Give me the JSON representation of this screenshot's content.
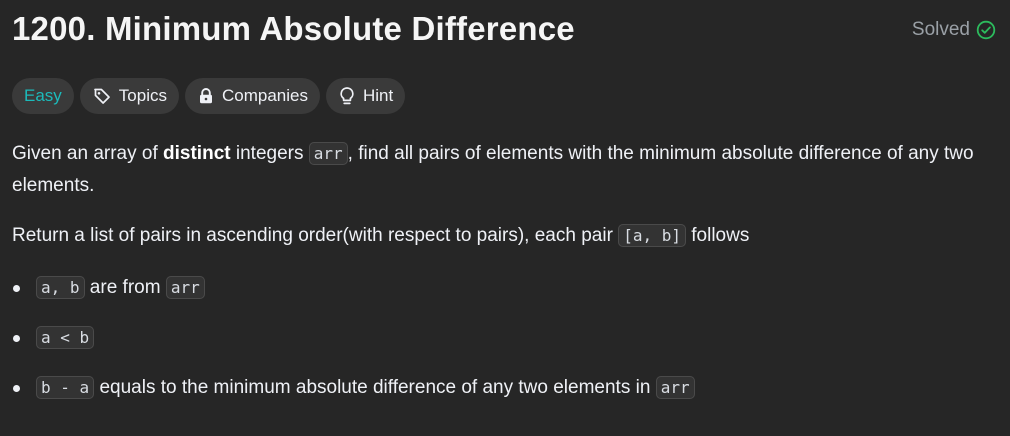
{
  "problem": {
    "title": "1200. Minimum Absolute Difference",
    "status": "Solved"
  },
  "tags": {
    "difficulty": "Easy",
    "topics": "Topics",
    "companies": "Companies",
    "hint": "Hint"
  },
  "description": {
    "p1": {
      "t1": "Given an array of ",
      "bold": "distinct",
      "t2": " integers ",
      "code": "arr",
      "t3": ", find all pairs of elements with the minimum absolute difference of any two elements."
    },
    "p2": {
      "t1": "Return a list of pairs in ascending order(with respect to pairs), each pair ",
      "code": "[a, b]",
      "t2": " follows"
    },
    "bullets": [
      {
        "code1": "a, b",
        "text": " are from ",
        "code2": "arr"
      },
      {
        "code1": "a < b"
      },
      {
        "code1": "b - a",
        "text": " equals to the minimum absolute difference of any two elements in ",
        "code2": "arr"
      }
    ]
  },
  "colors": {
    "background": "#262626",
    "easy": "#1cbaba",
    "solved_check": "#2cbb5d",
    "tag_bg": "#3a3a3a"
  }
}
